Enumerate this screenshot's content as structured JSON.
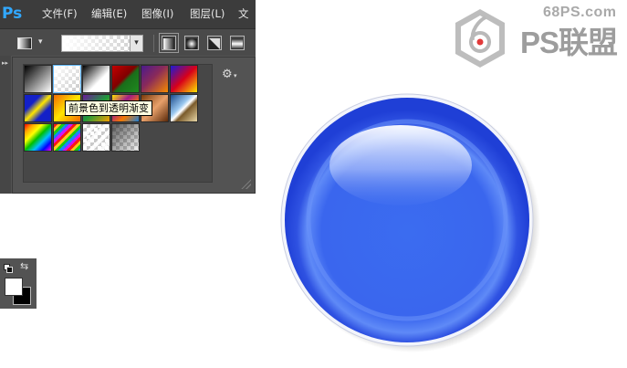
{
  "app": {
    "logo": "Ps",
    "menu": [
      "文件(F)",
      "编辑(E)",
      "图像(I)",
      "图层(L)",
      "文"
    ]
  },
  "options_bar": {
    "gradient_preview": "foreground-to-transparent",
    "modes": [
      "linear-gradient-icon",
      "radial-gradient-icon",
      "angle-gradient-icon",
      "reflected-gradient-icon"
    ],
    "active_mode": "linear"
  },
  "gradient_picker": {
    "tooltip": "前景色到透明渐变",
    "presets": [
      "black-white",
      "foreground-transparent",
      "black-white-2",
      "red-green",
      "violet-orange",
      "blue-red-yellow",
      "blue-yellow-blue",
      "orange-yellow-orange",
      "violet-green-orange",
      "yellow-violet-orange-blue",
      "copper",
      "chrome",
      "spectrum",
      "transparent-rainbow",
      "transparent-stripes",
      "neutral-density"
    ],
    "selected_index": 1,
    "gear_icon": "gear-icon"
  },
  "color_tool": {
    "foreground": "#ffffff",
    "background": "#000000"
  },
  "brand": {
    "url": "68PS.com",
    "name": "PS联盟"
  },
  "artwork": {
    "orb_color": "#2e55e6"
  }
}
